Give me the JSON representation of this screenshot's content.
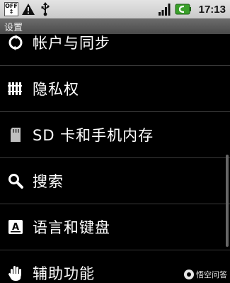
{
  "status_bar": {
    "time": "17:13",
    "off_badge_top": "OFF",
    "off_badge_bottom": "↕",
    "icons": [
      "sim-off-icon",
      "warning-icon",
      "usb-icon",
      "signal-icon",
      "battery-icon"
    ]
  },
  "title_bar": {
    "title": "设置"
  },
  "settings": {
    "items": [
      {
        "label": "帐户与同步",
        "icon": "sync-icon"
      },
      {
        "label": "隐私权",
        "icon": "privacy-icon"
      },
      {
        "label": "SD 卡和手机内存",
        "icon": "sd-card-icon"
      },
      {
        "label": "搜索",
        "icon": "search-icon"
      },
      {
        "label": "语言和键盘",
        "icon": "keyboard-icon"
      },
      {
        "label": "辅助功能",
        "icon": "accessibility-hand-icon"
      }
    ]
  },
  "watermark": {
    "text": "悟空问答"
  },
  "colors": {
    "background": "#000000",
    "status_bar": "#d6d6d6",
    "title_bar": "#5a5a5a",
    "battery_accent": "#3aa02a",
    "text": "#ffffff"
  }
}
